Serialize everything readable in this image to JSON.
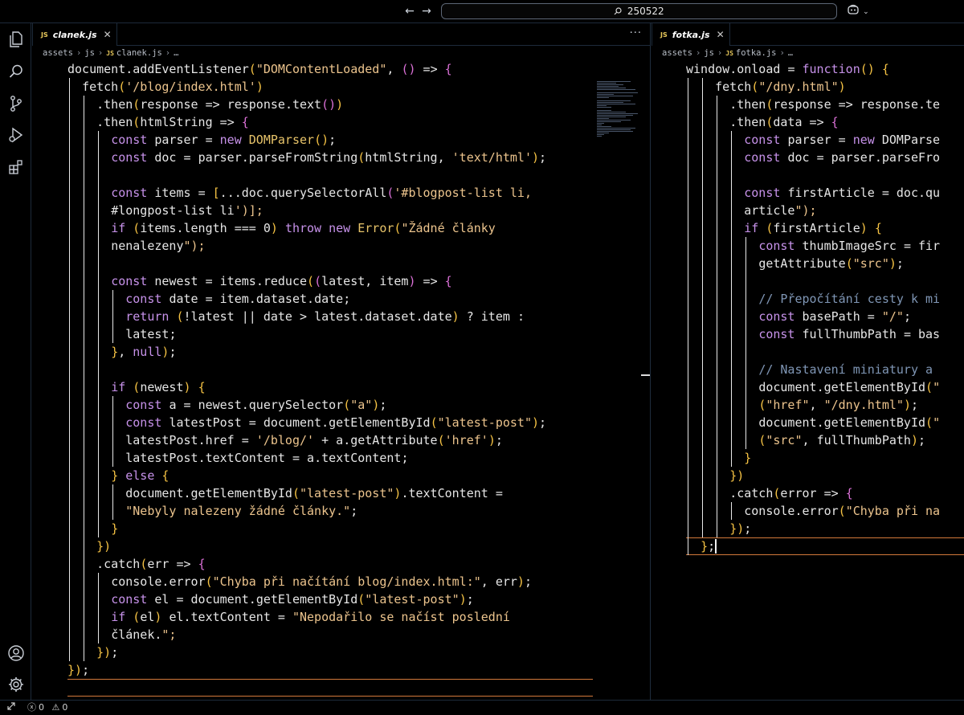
{
  "search": {
    "text": "250522"
  },
  "left_editor": {
    "tab_badge": "JS",
    "tab_label": "clanek.js",
    "more_label": "···",
    "breadcrumb": [
      "assets",
      "js",
      "clanek.js",
      "…"
    ],
    "lines": [
      "document.addEventListener(\"DOMContentLoaded\", () => {",
      "  fetch('/blog/index.html')",
      "    .then(response => response.text())",
      "    .then(htmlString => {",
      "      const parser = new DOMParser();",
      "      const doc = parser.parseFromString(htmlString, 'text/html');",
      "",
      "      const items = [...doc.querySelectorAll('#blogpost-list li,",
      "      #longpost-list li')];",
      "      if (items.length === 0) throw new Error(\"Žádné články",
      "      nenalezeny\");",
      "",
      "      const newest = items.reduce((latest, item) => {",
      "        const date = item.dataset.date;",
      "        return (!latest || date > latest.dataset.date) ? item :",
      "        latest;",
      "      }, null);",
      "",
      "      if (newest) {",
      "        const a = newest.querySelector(\"a\");",
      "        const latestPost = document.getElementById(\"latest-post\");",
      "        latestPost.href = '/blog/' + a.getAttribute('href');",
      "        latestPost.textContent = a.textContent;",
      "      } else {",
      "        document.getElementById(\"latest-post\").textContent =",
      "        \"Nebyly nalezeny žádné články.\";",
      "      }",
      "    })",
      "    .catch(err => {",
      "      console.error(\"Chyba při načítání blog/index.html:\", err);",
      "      const el = document.getElementById(\"latest-post\");",
      "      if (el) el.textContent = \"Nepodařilo se načíst poslední",
      "      článek.\";",
      "    });",
      "});",
      ""
    ]
  },
  "right_editor": {
    "tab_badge": "JS",
    "tab_label": "fotka.js",
    "breadcrumb": [
      "assets",
      "js",
      "fotka.js",
      "…"
    ],
    "lines": [
      "window.onload = function() {",
      "    fetch(\"/dny.html\")",
      "      .then(response => response.te",
      "      .then(data => {",
      "        const parser = new DOMParse",
      "        const doc = parser.parseFro",
      "",
      "        const firstArticle = doc.qu",
      "        article\");",
      "        if (firstArticle) {",
      "          const thumbImageSrc = fir",
      "          getAttribute(\"src\");",
      "",
      "          // Přepočítání cesty k mi",
      "          const basePath = \"/\";",
      "          const fullThumbPath = bas",
      "",
      "          // Nastavení miniatury a",
      "          document.getElementById(\"",
      "          (\"href\", \"/dny.html\");",
      "          document.getElementById(\"",
      "          (\"src\", fullThumbPath);",
      "        }",
      "      })",
      "      .catch(error => {",
      "        console.error(\"Chyba při na",
      "      });",
      "  };"
    ]
  },
  "status": {
    "errors": "0",
    "warnings": "0"
  },
  "icons": {
    "back": "arrow-left-icon",
    "forward": "arrow-right-icon",
    "search": "search-icon",
    "copilot": "copilot-icon",
    "explorer": "files-icon",
    "search_view": "search-icon",
    "scm": "source-control-icon",
    "debug": "run-debug-icon",
    "extensions": "extensions-icon",
    "accounts": "account-icon",
    "settings": "gear-icon",
    "remote": "remote-icon",
    "error": "error-icon",
    "warning": "warning-icon"
  },
  "colors": {
    "keyword": "#c792ea",
    "type": "#e8c46a",
    "string": "#ecc48d",
    "comment": "#7f96b5",
    "active_line_border": "#d3793b"
  }
}
